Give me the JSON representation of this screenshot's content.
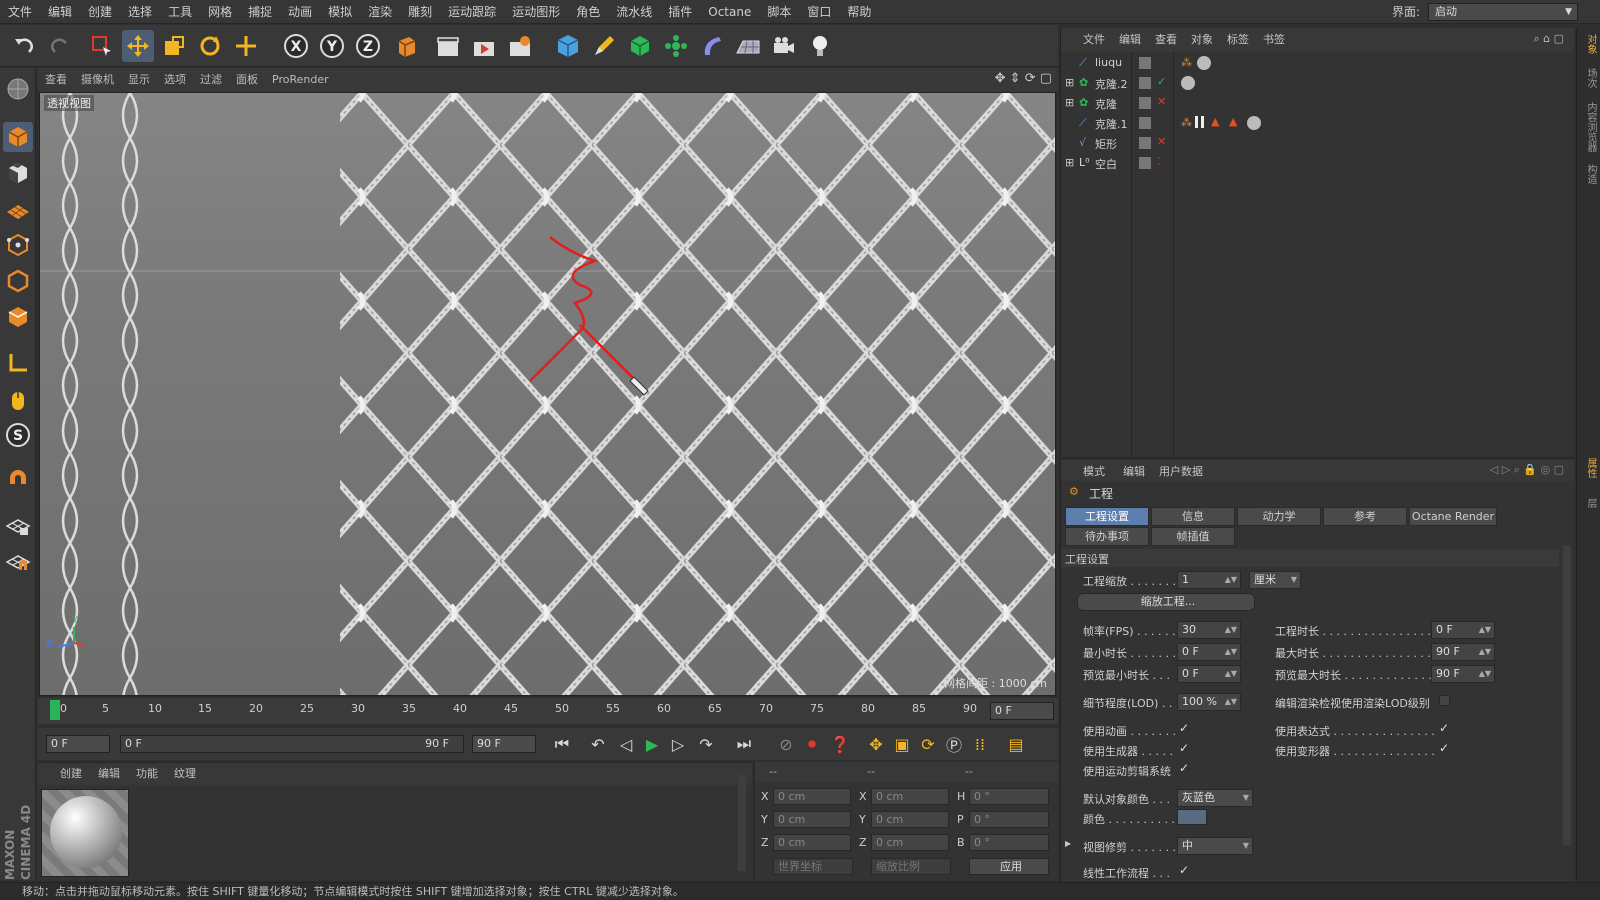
{
  "menubar": {
    "items": [
      "文件",
      "编辑",
      "创建",
      "选择",
      "工具",
      "网格",
      "捕捉",
      "动画",
      "模拟",
      "渲染",
      "雕刻",
      "运动跟踪",
      "运动图形",
      "角色",
      "流水线",
      "插件",
      "Octane",
      "脚本",
      "窗口",
      "帮助"
    ],
    "layout_label": "界面:",
    "layout_value": "启动"
  },
  "viewport": {
    "menu": [
      "查看",
      "摄像机",
      "显示",
      "选项",
      "过滤",
      "面板",
      "ProRender"
    ],
    "label": "透视视图",
    "grid_note": "网格间距 : 1000 cm",
    "axis_y": "Y",
    "axis_z": "Z"
  },
  "timeline": {
    "ticks": [
      "0",
      "5",
      "10",
      "15",
      "20",
      "25",
      "30",
      "35",
      "40",
      "45",
      "50",
      "55",
      "60",
      "65",
      "70",
      "75",
      "80",
      "85",
      "90"
    ],
    "current_frame": "0 F",
    "start_field": "0 F",
    "range_start": "0 F",
    "range_end": "90 F",
    "end_field": "90 F"
  },
  "material_panel": {
    "menu": [
      "创建",
      "编辑",
      "功能",
      "纹理"
    ]
  },
  "coord_panel": {
    "header": [
      "--",
      "--",
      "--"
    ],
    "rows": [
      {
        "a": "X",
        "av": "0 cm",
        "b": "X",
        "bv": "0 cm",
        "c": "H",
        "cv": "0 °"
      },
      {
        "a": "Y",
        "av": "0 cm",
        "b": "Y",
        "bv": "0 cm",
        "c": "P",
        "cv": "0 °"
      },
      {
        "a": "Z",
        "av": "0 cm",
        "b": "Z",
        "bv": "0 cm",
        "c": "B",
        "cv": "0 °"
      }
    ],
    "world_select": "世界坐标",
    "scale_select": "缩放比例",
    "apply": "应用"
  },
  "object_manager": {
    "menu": [
      "文件",
      "编辑",
      "查看",
      "对象",
      "标签",
      "书签"
    ],
    "objects": [
      {
        "name": "liuqu"
      },
      {
        "name": "克隆.2"
      },
      {
        "name": "克隆"
      },
      {
        "name": "克隆.1"
      },
      {
        "name": "矩形"
      },
      {
        "name": "空白"
      }
    ]
  },
  "attribute_manager": {
    "menu": [
      "模式",
      "编辑",
      "用户数据"
    ],
    "title": "工程",
    "tabs_row1": [
      "工程设置",
      "信息",
      "动力学",
      "参考",
      "Octane Render"
    ],
    "tabs_row2": [
      "待办事项",
      "帧插值"
    ],
    "section": "工程设置",
    "scale_label": "工程缩放 . . . . . . .",
    "scale_value": "1",
    "scale_unit": "厘米",
    "scale_button": "缩放工程...",
    "fps_label": "帧率(FPS) . . . . . .",
    "fps_value": "30",
    "duration_label": "工程时长 . . . . . . . . . . . . . . . .",
    "duration_value": "0 F",
    "min_label": "最小时长 . . . . . . .",
    "min_value": "0 F",
    "max_label": "最大时长 . . . . . . . . . . . . . . . .",
    "max_value": "90 F",
    "pmin_label": "预览最小时长 . . .",
    "pmin_value": "0 F",
    "pmax_label": "预览最大时长 . . . . . . . . . . . . .",
    "pmax_value": "90 F",
    "lod_label": "细节程度(LOD) . . .",
    "lod_value": "100 %",
    "lod_render_label": "编辑渲染检视使用渲染LOD级别",
    "use_anim_label": "使用动画 . . . . . . .",
    "use_expr_label": "使用表达式 . . . . . . . . . . . . . . .",
    "use_gen_label": "使用生成器 . . . . .",
    "use_deform_label": "使用变形器 . . . . . . . . . . . . . . .",
    "use_motion_label": "使用运动剪辑系统",
    "obj_color_label": "默认对象颜色 . . .",
    "obj_color_value": "灰蓝色",
    "color_label": "颜色 . . . . . . . . . . .",
    "clip_label": "视图修剪 . . . . . . .",
    "clip_value": "中",
    "linear_label": "线性工作流程 . . .",
    "check": "✓"
  },
  "right_tabs": [
    "对象",
    "场次",
    "内容浏览器",
    "构造",
    "属性",
    "层"
  ],
  "status": "移动：点击并拖动鼠标移动元素。按住 SHIFT 键量化移动；节点编辑模式时按住 SHIFT 键增加选择对象；按住 CTRL 键减少选择对象。",
  "colors": {
    "accent": "#5c7fae",
    "stroke": "#e0201c",
    "playhead": "#29b35a"
  }
}
